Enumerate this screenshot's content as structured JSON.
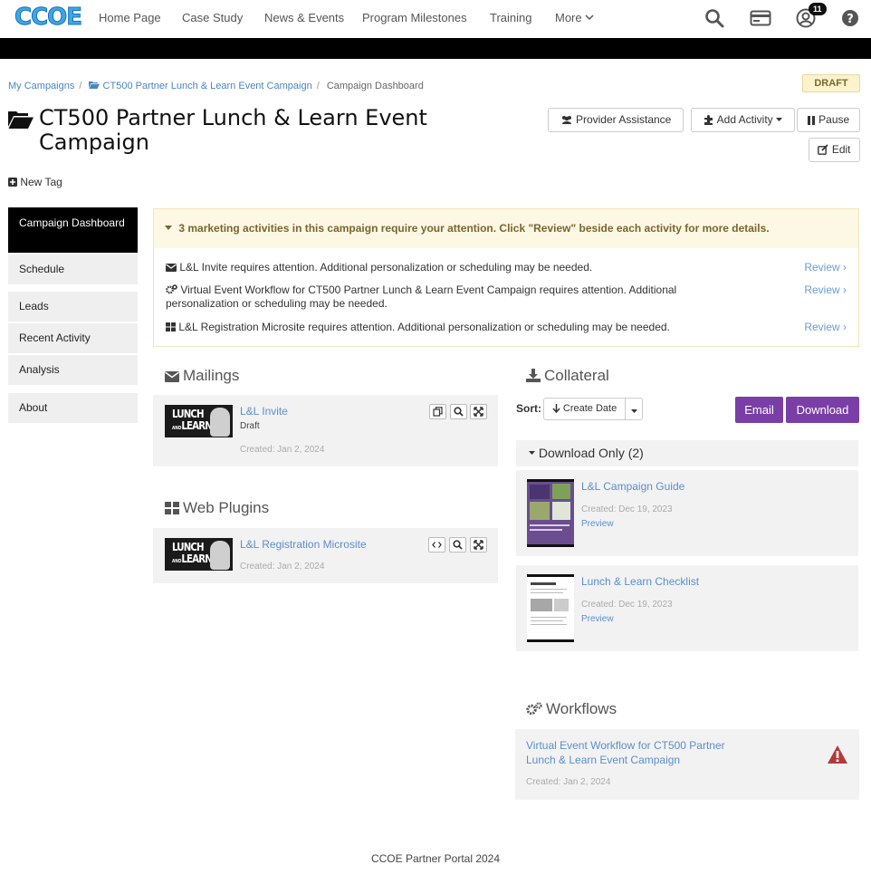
{
  "header": {
    "logo_text": "CCOE",
    "nav": [
      "Home Page",
      "Case Study",
      "News & Events",
      "Program Milestones",
      "Training",
      "More"
    ],
    "notification_count": "11"
  },
  "breadcrumb": {
    "items": [
      "My Campaigns",
      "CT500 Partner Lunch & Learn Event Campaign"
    ],
    "current": "Campaign Dashboard"
  },
  "status_badge": "DRAFT",
  "title": "CT500 Partner Lunch & Learn Event Campaign",
  "new_tag": "New Tag",
  "buttons": {
    "provider_assistance": "Provider Assistance",
    "add_activity": "Add Activity",
    "pause": "Pause",
    "edit": "Edit"
  },
  "sidebar": {
    "items": [
      "Campaign Dashboard",
      "Schedule",
      "Leads",
      "Recent Activity",
      "Analysis",
      "About"
    ]
  },
  "alert": {
    "heading": "3 marketing activities in this campaign require your attention. Click \"Review\" beside each activity for more details.",
    "rows": [
      "L&L Invite requires attention. Additional personalization or scheduling may be needed.",
      "Virtual Event Workflow for CT500 Partner Lunch & Learn Event Campaign requires attention. Additional personalization or scheduling may be needed.",
      "L&L Registration Microsite requires attention. Additional personalization or scheduling may be needed."
    ],
    "review_label": "Review ›"
  },
  "mailings": {
    "title": "Mailings",
    "item": {
      "name": "L&L Invite",
      "status": "Draft",
      "created": "Created: Jan 2, 2024"
    }
  },
  "web_plugins": {
    "title": "Web Plugins",
    "item": {
      "name": "L&L Registration Microsite",
      "created": "Created: Jan 2, 2024"
    }
  },
  "thumb_text": {
    "line1": "LUNCH",
    "line2": "LEARN",
    "and": "AND"
  },
  "collateral": {
    "title": "Collateral",
    "sort_label": "Sort:",
    "sort_value": "Create Date",
    "email_button": "Email",
    "download_button": "Download",
    "group_label": "Download Only (2)",
    "items": [
      {
        "name": "L&L Campaign Guide",
        "created": "Created: Dec 19, 2023",
        "preview": "Preview"
      },
      {
        "name": "Lunch & Learn Checklist",
        "created": "Created: Dec 19, 2023",
        "preview": "Preview"
      }
    ]
  },
  "workflows": {
    "title": "Workflows",
    "item": {
      "name": "Virtual Event Workflow for CT500 Partner Lunch & Learn Event Campaign",
      "created": "Created: Jan 2, 2024"
    }
  },
  "footer": "CCOE Partner Portal 2024",
  "colors": {
    "accent_purple": "#7a3fa6",
    "link_blue": "#5b8fcc",
    "alert_bg": "#fcf8e3",
    "warning_red": "#b23a3a"
  }
}
